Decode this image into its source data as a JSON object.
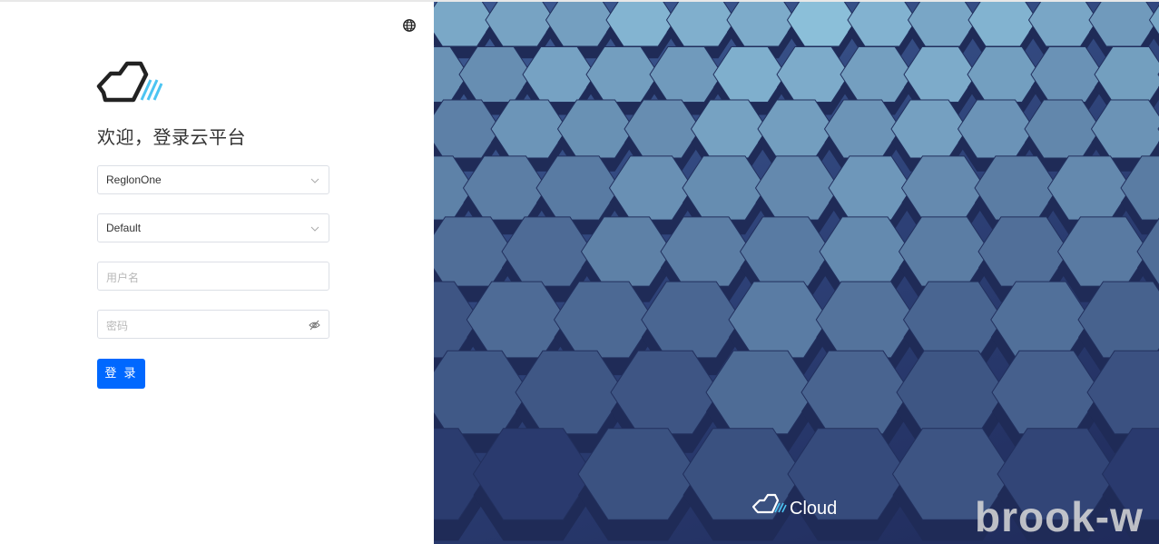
{
  "header": {
    "language_icon": "globe-icon"
  },
  "login": {
    "welcome": "欢迎，登录云平台",
    "region": {
      "value": "ReglonOne"
    },
    "domain": {
      "value": "Default"
    },
    "username": {
      "placeholder": "用户名"
    },
    "password": {
      "placeholder": "密码"
    },
    "submit_label": "登 录"
  },
  "banner": {
    "brand": "Cloud",
    "watermark": "brook-w"
  },
  "colors": {
    "primary": "#0068ff",
    "logo_dark": "#222222",
    "logo_accent": "#4cc4f2",
    "hex_light": "#8ec3dd",
    "hex_dark": "#2a3a6e"
  }
}
